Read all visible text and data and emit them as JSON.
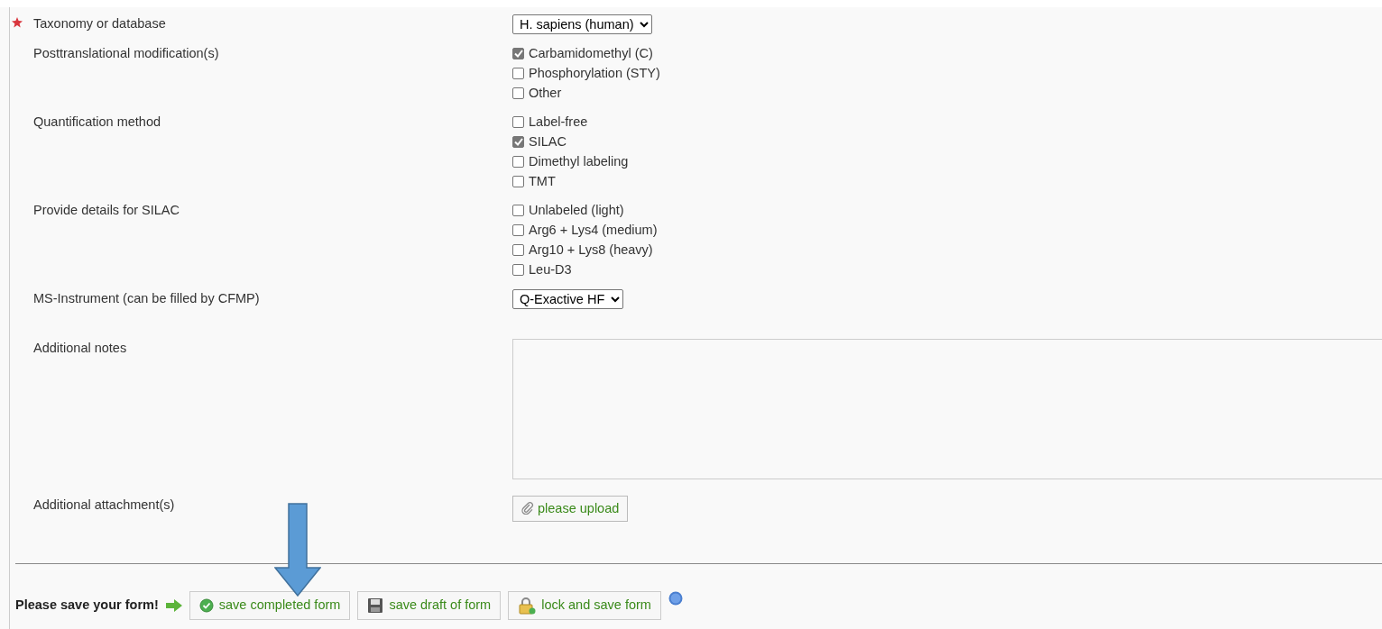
{
  "fields": [
    {
      "kind": "select",
      "label": "Taxonomy or database",
      "required": true,
      "value": "H. sapiens (human)"
    },
    {
      "kind": "checkboxes",
      "label": "Posttranslational modification(s)",
      "required": false,
      "options": [
        {
          "label": "Carbamidomethyl (C)",
          "checked": true
        },
        {
          "label": "Phosphorylation (STY)",
          "checked": false
        },
        {
          "label": "Other",
          "checked": false
        }
      ]
    },
    {
      "kind": "checkboxes",
      "label": "Quantification method",
      "required": false,
      "options": [
        {
          "label": "Label-free",
          "checked": false
        },
        {
          "label": "SILAC",
          "checked": true
        },
        {
          "label": "Dimethyl labeling",
          "checked": false
        },
        {
          "label": "TMT",
          "checked": false
        }
      ]
    },
    {
      "kind": "checkboxes",
      "label": "Provide details for SILAC",
      "required": false,
      "options": [
        {
          "label": "Unlabeled (light)",
          "checked": false
        },
        {
          "label": "Arg6 + Lys4 (medium)",
          "checked": false
        },
        {
          "label": "Arg10 + Lys8 (heavy)",
          "checked": false
        },
        {
          "label": "Leu-D3",
          "checked": false
        }
      ]
    },
    {
      "kind": "select",
      "label": "MS-Instrument (can be filled by CFMP)",
      "required": false,
      "value": "Q-Exactive HF"
    },
    {
      "kind": "textarea",
      "label": "Additional notes",
      "required": false
    },
    {
      "kind": "upload",
      "label": "Additional attachment(s)",
      "required": false,
      "button": "please upload"
    }
  ],
  "footer": {
    "prompt": "Please save your form!",
    "buttons": [
      {
        "kind": "complete",
        "label": "save completed form"
      },
      {
        "kind": "draft",
        "label": "save draft of form"
      },
      {
        "kind": "lock",
        "label": "lock and save form"
      }
    ]
  }
}
